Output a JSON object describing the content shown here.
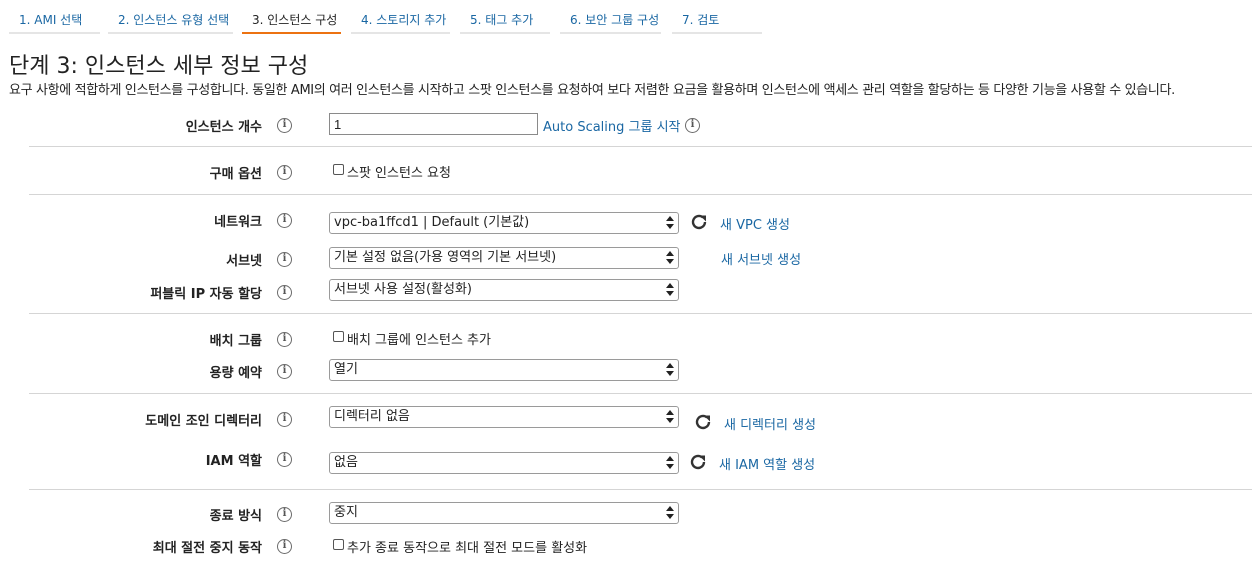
{
  "steps": [
    {
      "label": "1. AMI 선택"
    },
    {
      "label": "2. 인스턴스 유형 선택"
    },
    {
      "label": "3. 인스턴스 구성"
    },
    {
      "label": "4. 스토리지 추가"
    },
    {
      "label": "5. 태그 추가"
    },
    {
      "label": "6. 보안 그룹 구성"
    },
    {
      "label": "7. 검토"
    }
  ],
  "page": {
    "title": "단계 3: 인스턴스 세부 정보 구성",
    "description": "요구 사항에 적합하게 인스턴스를 구성합니다. 동일한 AMI의 여러 인스턴스를 시작하고 스팟 인스턴스를 요청하여 보다 저렴한 요금을 활용하며 인스턴스에 액세스 관리 역할을 할당하는 등 다양한 기능을 사용할 수 있습니다."
  },
  "info_icon": "i",
  "form": {
    "instance_count": {
      "label": "인스턴스 개수",
      "value": "1",
      "link": "Auto Scaling 그룹 시작"
    },
    "purchase_option": {
      "label": "구매 옵션",
      "checkbox": "스팟 인스턴스 요청"
    },
    "network": {
      "label": "네트워크",
      "value": "vpc-ba1ffcd1 | Default (기본값)",
      "link": "새 VPC 생성"
    },
    "subnet": {
      "label": "서브넷",
      "value": "기본 설정 없음(가용 영역의 기본 서브넷)",
      "link": "새 서브넷 생성"
    },
    "public_ip": {
      "label": "퍼블릭 IP 자동 할당",
      "value": "서브넷 사용 설정(활성화)"
    },
    "placement_group": {
      "label": "배치 그룹",
      "checkbox": "배치 그룹에 인스턴스 추가"
    },
    "capacity_reservation": {
      "label": "용량 예약",
      "value": "열기"
    },
    "domain_join": {
      "label": "도메인 조인 디렉터리",
      "value": "디렉터리 없음",
      "link": "새 디렉터리 생성"
    },
    "iam_role": {
      "label": "IAM 역할",
      "value": "없음",
      "link": "새 IAM 역할 생성"
    },
    "shutdown_behavior": {
      "label": "종료 방식",
      "value": "중지"
    },
    "stop_hibernate": {
      "label": "최대 절전 중지 동작",
      "checkbox": "추가 종료 동작으로 최대 절전 모드를 활성화"
    }
  }
}
